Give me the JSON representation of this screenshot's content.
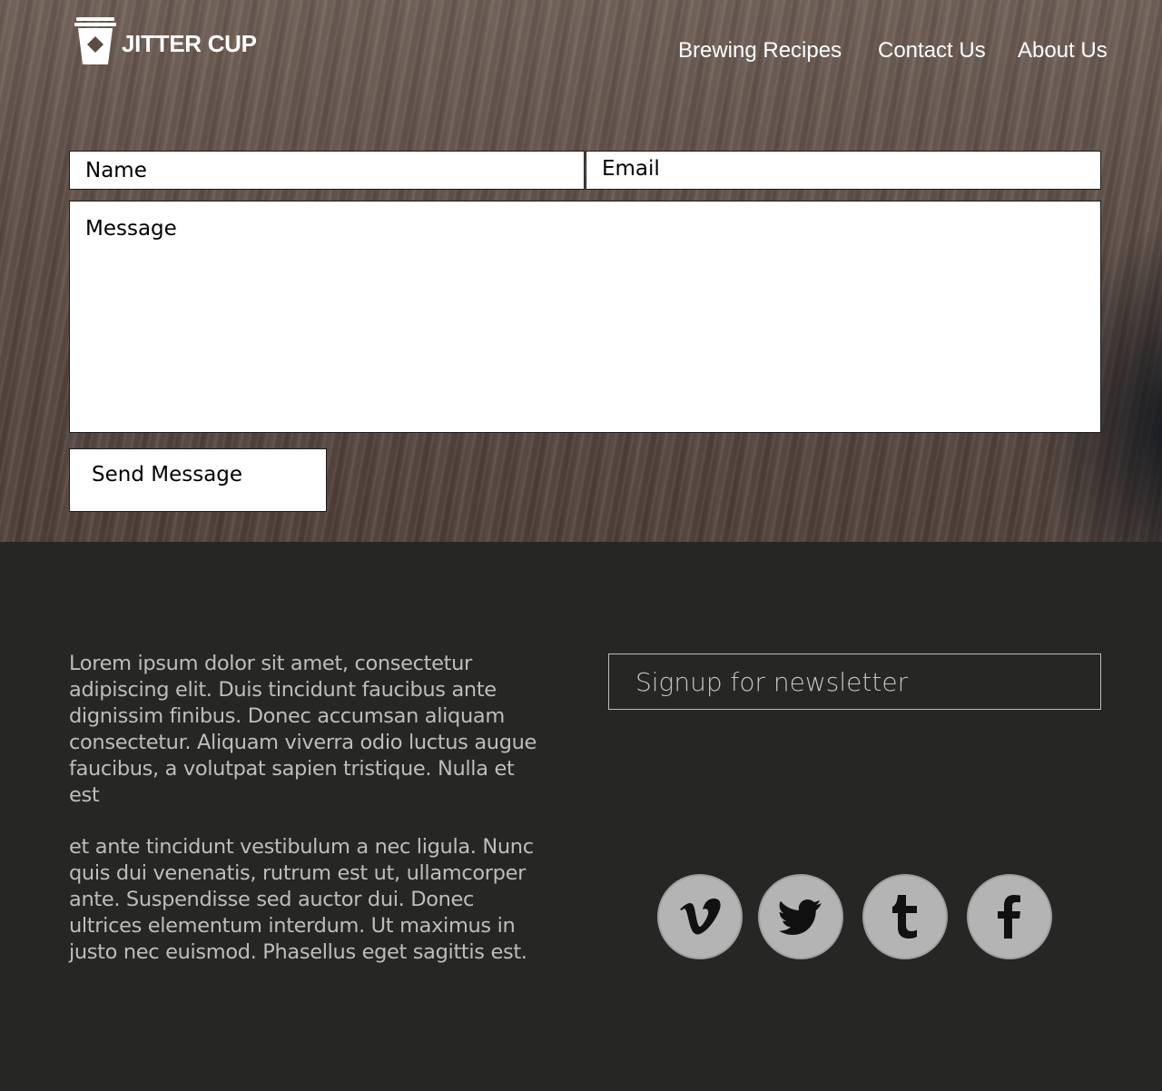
{
  "brand": {
    "name": "JITTER CUP",
    "logo_icon": "coffee-cup-icon"
  },
  "nav": {
    "items": [
      {
        "label": "Brewing Recipes"
      },
      {
        "label": "Contact Us"
      },
      {
        "label": "About Us"
      }
    ]
  },
  "contact_form": {
    "name_placeholder": "Name",
    "email_placeholder": "Email",
    "message_placeholder": "Message",
    "send_label": "Send Message"
  },
  "footer": {
    "paragraphs": [
      "Lorem ipsum dolor sit amet, consectetur adipiscing elit. Duis tincidunt faucibus ante dignissim finibus. Donec accumsan aliquam consectetur. Aliquam viverra odio luctus augue faucibus, a volutpat sapien tristique. Nulla et est",
      "et ante tincidunt vestibulum a nec ligula. Nunc quis dui venenatis, rutrum est ut, ullamcorper ante. Suspendisse sed auctor dui. Donec ultrices elementum interdum. Ut maximus in justo nec euismod. Phasellus eget sagittis est."
    ],
    "newsletter_placeholder": "Signup for newsletter",
    "social": [
      {
        "icon": "vimeo-icon"
      },
      {
        "icon": "twitter-icon"
      },
      {
        "icon": "tumblr-icon"
      },
      {
        "icon": "facebook-icon"
      }
    ]
  },
  "colors": {
    "footer_bg": "#262624",
    "footer_text": "#bdbdbd",
    "social_circle": "#b4b4b4"
  }
}
